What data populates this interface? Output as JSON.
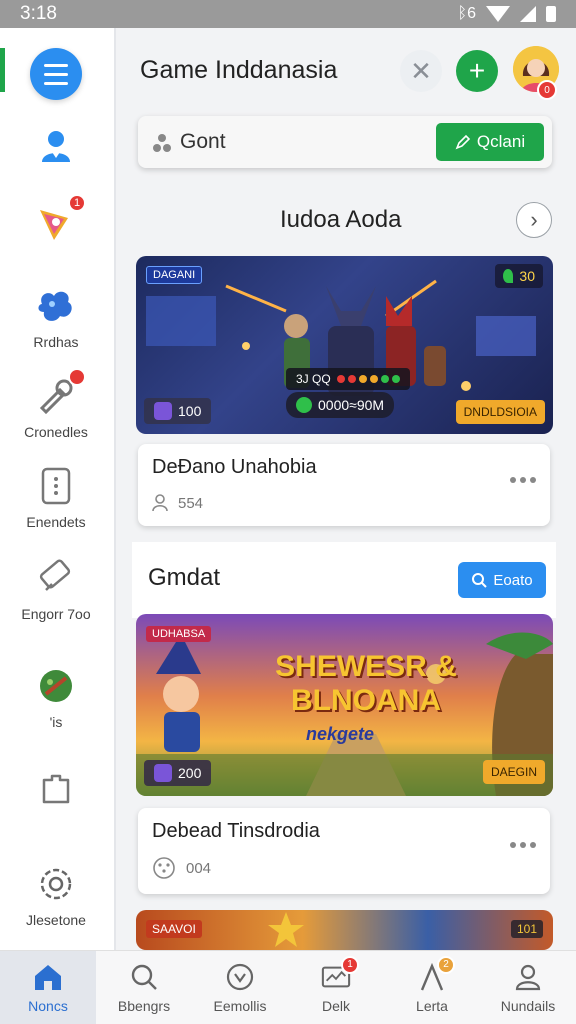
{
  "status_bar": {
    "time": "3:18",
    "network": "ᛒ6"
  },
  "header": {
    "title": "Game Inddanasia",
    "close_glyph": "✕",
    "add_glyph": "+",
    "avatar_badge": "0"
  },
  "search": {
    "text": "Gont",
    "action_label": "Qclani",
    "action_icon": "edit-icon"
  },
  "sidebar": {
    "items": [
      {
        "label": "",
        "icon": "person-pin-icon",
        "badge": ""
      },
      {
        "label": "",
        "icon": "rocket-icon",
        "badge": "1"
      },
      {
        "label": "Rrdhas",
        "icon": "blue-splash-icon",
        "badge": ""
      },
      {
        "label": "Cronedles",
        "icon": "tool-icon",
        "badge": ""
      },
      {
        "label": "Enendets",
        "icon": "kebab-icon",
        "badge": ""
      },
      {
        "label": "Engorr 7oo",
        "icon": "ticket-icon",
        "badge": ""
      },
      {
        "label": "'is",
        "icon": "game-leaf-icon",
        "badge": ""
      },
      {
        "label": "",
        "icon": "puzzle-icon",
        "badge": ""
      },
      {
        "label": "Jlesetone",
        "icon": "gear-icon",
        "badge": ""
      }
    ]
  },
  "section1": {
    "title": "Iudoa Aoda",
    "banner": {
      "tag_top_left": "DAGANI",
      "score_top_right": "30",
      "stat_line": "3J QQ",
      "progress_label": "0000≈90M",
      "count": "100",
      "badge": "DNDLDSIOIA"
    },
    "card": {
      "title": "DeĐano Unahobia",
      "meta": "554"
    }
  },
  "section2": {
    "title": "Gmdat",
    "action_label": "Eoato",
    "banner": {
      "tag_top_left": "UDHABSA",
      "headline_1": "SHEWESR &",
      "headline_2": "BLNOANA",
      "subline": "nekgete",
      "count": "200",
      "badge": "DAEGIN"
    },
    "card": {
      "title": "Debead Tinsdrodia",
      "meta": "004"
    }
  },
  "section3": {
    "banner": {
      "tag_top_left": "SAAVOI",
      "score": "101"
    }
  },
  "bottom_nav": [
    {
      "label": "Noncs",
      "icon": "home-icon",
      "badge": "",
      "active": true
    },
    {
      "label": "Bbengrs",
      "icon": "search-icon",
      "badge": "",
      "active": false
    },
    {
      "label": "Eemollis",
      "icon": "compass-icon",
      "badge": "",
      "active": false
    },
    {
      "label": "Delk",
      "icon": "mail-icon",
      "badge": "1",
      "active": false
    },
    {
      "label": "Lerta",
      "icon": "lambda-icon",
      "badge": "2",
      "active": false
    },
    {
      "label": "Nundails",
      "icon": "profile-icon",
      "badge": "",
      "active": false
    }
  ],
  "colors": {
    "accent_green": "#1fa54a",
    "accent_blue": "#2b8ef0",
    "badge_red": "#e53935",
    "badge_orange": "#f0a92b"
  }
}
